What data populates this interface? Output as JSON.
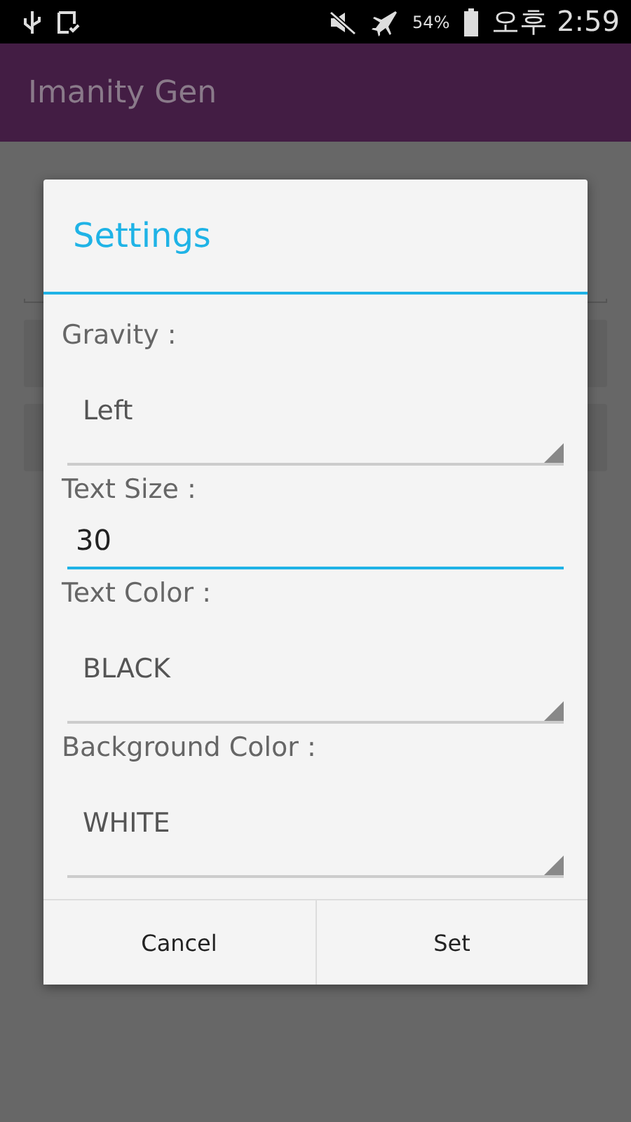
{
  "status_bar": {
    "battery": "54%",
    "time": "오후 2:59"
  },
  "app_bar": {
    "title": "Imanity Gen"
  },
  "dialog": {
    "title": "Settings",
    "fields": [
      {
        "kind": "spinner",
        "label": "Gravity :",
        "value": "Left"
      },
      {
        "kind": "edit",
        "label": "Text Size :",
        "value": "30"
      },
      {
        "kind": "spinner",
        "label": "Text Color  :",
        "value": "BLACK"
      },
      {
        "kind": "spinner",
        "label": "Background Color  :",
        "value": "WHITE"
      }
    ],
    "buttons": [
      "Cancel",
      "Set"
    ]
  }
}
